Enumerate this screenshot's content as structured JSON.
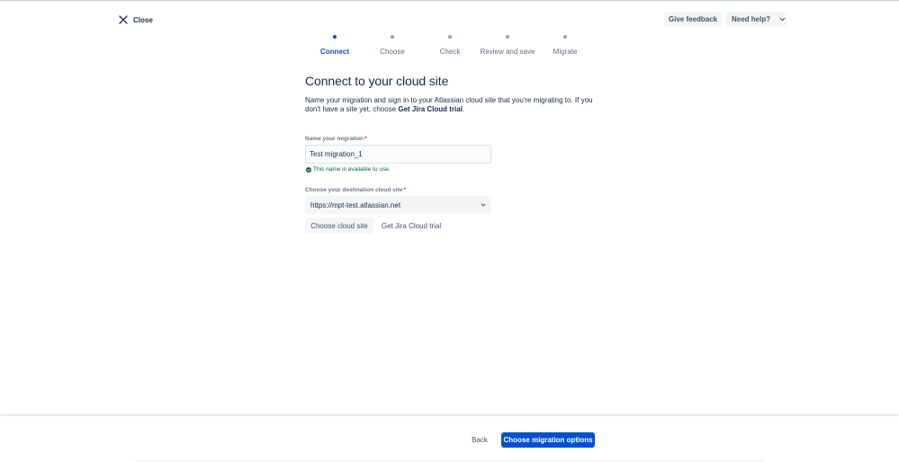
{
  "header": {
    "close_label": "Close",
    "feedback_label": "Give feedback",
    "help_label": "Need help?"
  },
  "stepper": {
    "steps": [
      {
        "label": "Connect",
        "active": true
      },
      {
        "label": "Choose",
        "active": false
      },
      {
        "label": "Check",
        "active": false
      },
      {
        "label": "Review and save",
        "active": false
      },
      {
        "label": "Migrate",
        "active": false
      }
    ]
  },
  "main": {
    "title": "Connect to your cloud site",
    "description_prefix": "Name your migration and sign in to your Atlassian cloud site that you're migrating to. If you don't have a site yet, choose ",
    "description_bold": "Get Jira Cloud trial",
    "description_suffix": "."
  },
  "form": {
    "name_label": "Name your migration",
    "name_value": "Test migration_1",
    "required_mark": "*",
    "validation_message": "This name is available to use.",
    "site_label": "Choose your destination cloud site",
    "site_value": "https://mpt-test.atlassian.net",
    "choose_site_label": "Choose cloud site",
    "trial_label": "Get Jira Cloud trial"
  },
  "footer": {
    "back_label": "Back",
    "next_label": "Choose migration options"
  },
  "colors": {
    "primary": "#0052cc",
    "success": "#006644",
    "required": "#de350b",
    "text": "#172b4d",
    "subtle_bg": "#f4f5f7"
  },
  "icons": {
    "close": "close-icon",
    "help_chevron": "chevron-down-icon",
    "validation": "check-circle-icon",
    "select_chevron": "chevron-down-icon"
  }
}
